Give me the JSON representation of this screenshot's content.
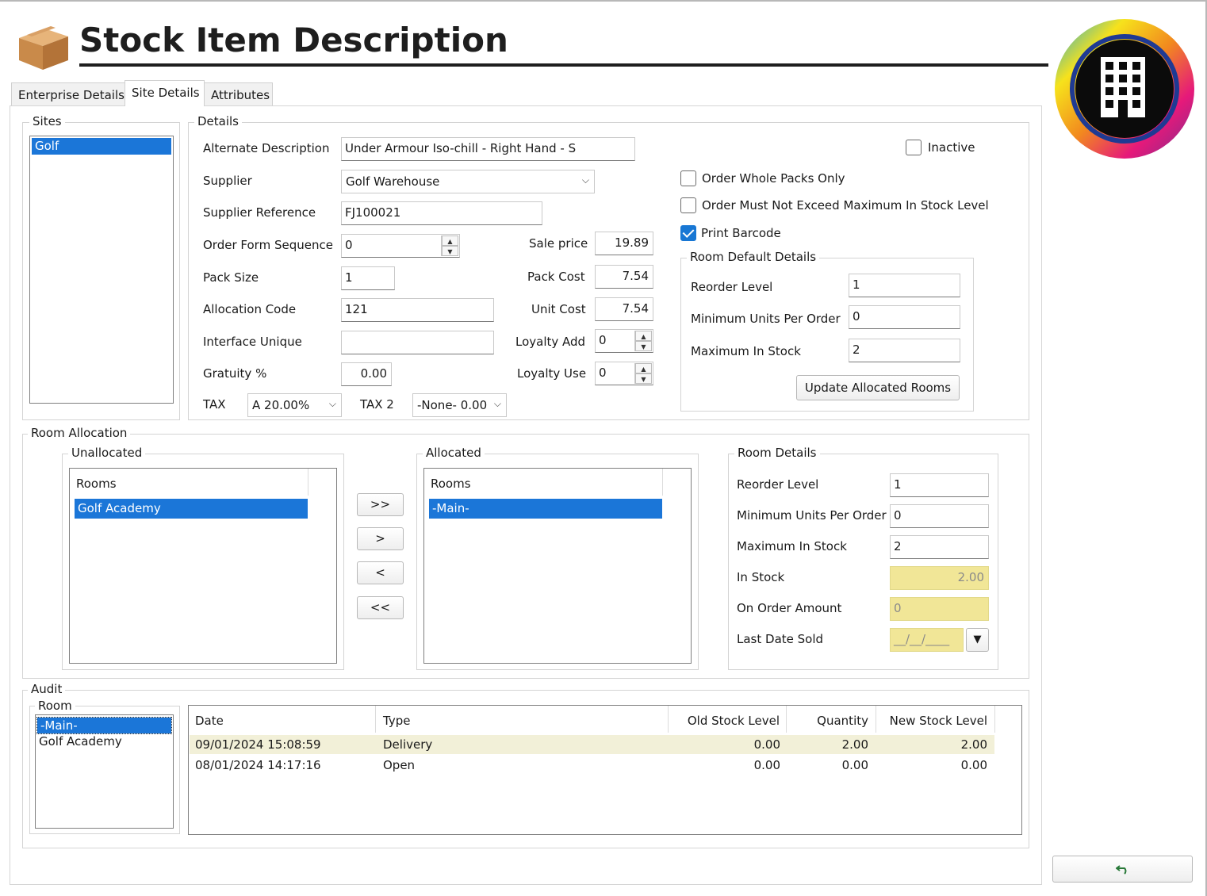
{
  "header": {
    "title": "Stock Item Description",
    "icon": "cardboard-box-icon",
    "logo": "building-ring-logo"
  },
  "tabs": [
    {
      "label": "Enterprise Details",
      "active": false
    },
    {
      "label": "Site Details",
      "active": true
    },
    {
      "label": "Attributes",
      "active": false
    }
  ],
  "sites": {
    "legend": "Sites",
    "items": [
      "Golf"
    ],
    "selected": "Golf"
  },
  "details": {
    "legend": "Details",
    "alternate_description": {
      "label": "Alternate Description",
      "value": "Under Armour Iso-chill - Right Hand - S"
    },
    "supplier": {
      "label": "Supplier",
      "value": "Golf Warehouse"
    },
    "supplier_reference": {
      "label": "Supplier Reference",
      "value": "FJ100021"
    },
    "order_form_sequence": {
      "label": "Order Form Sequence",
      "value": "0"
    },
    "pack_size": {
      "label": "Pack Size",
      "value": "1"
    },
    "allocation_code": {
      "label": "Allocation Code",
      "value": "121"
    },
    "interface_unique": {
      "label": "Interface Unique",
      "value": ""
    },
    "gratuity": {
      "label": "Gratuity %",
      "value": "0.00"
    },
    "tax": {
      "label": "TAX",
      "value": "A 20.00%"
    },
    "tax2": {
      "label": "TAX 2",
      "value": "-None- 0.00"
    },
    "sale_price": {
      "label": "Sale price",
      "value": "19.89"
    },
    "pack_cost": {
      "label": "Pack Cost",
      "value": "7.54"
    },
    "unit_cost": {
      "label": "Unit Cost",
      "value": "7.54"
    },
    "loyalty_add": {
      "label": "Loyalty Add",
      "value": "0"
    },
    "loyalty_use": {
      "label": "Loyalty Use",
      "value": "0"
    },
    "inactive": {
      "label": "Inactive",
      "checked": false
    },
    "order_whole_packs": {
      "label": "Order Whole Packs Only",
      "checked": false
    },
    "order_not_exceed": {
      "label": "Order Must Not Exceed Maximum In Stock Level",
      "checked": false
    },
    "print_barcode": {
      "label": "Print Barcode",
      "checked": true
    }
  },
  "room_defaults": {
    "legend": "Room Default Details",
    "reorder_level": {
      "label": "Reorder Level",
      "value": "1"
    },
    "min_units": {
      "label": "Minimum Units Per Order",
      "value": "0"
    },
    "max_in_stock": {
      "label": "Maximum In Stock",
      "value": "2"
    },
    "update_button": "Update Allocated Rooms"
  },
  "room_allocation": {
    "legend": "Room Allocation",
    "unallocated": {
      "legend": "Unallocated",
      "header": "Rooms",
      "items": [
        "Golf Academy"
      ]
    },
    "allocated": {
      "legend": "Allocated",
      "header": "Rooms",
      "items": [
        "-Main-"
      ]
    },
    "buttons": {
      "move_all_right": ">>",
      "move_right": ">",
      "move_left": "<",
      "move_all_left": "<<"
    }
  },
  "room_details": {
    "legend": "Room Details",
    "reorder_level": {
      "label": "Reorder Level",
      "value": "1"
    },
    "min_units": {
      "label": "Minimum Units Per Order",
      "value": "0"
    },
    "max_in_stock": {
      "label": "Maximum In Stock",
      "value": "2"
    },
    "in_stock": {
      "label": "In Stock",
      "value": "2.00"
    },
    "on_order": {
      "label": "On Order Amount",
      "value": "0"
    },
    "last_date_sold": {
      "label": "Last Date Sold",
      "value": "__/__/____"
    }
  },
  "audit": {
    "legend": "Audit",
    "room_legend": "Room",
    "rooms": [
      "-Main-",
      "Golf Academy"
    ],
    "columns": [
      "Date",
      "Type",
      "Old Stock Level",
      "Quantity",
      "New Stock Level"
    ],
    "rows": [
      {
        "date": "09/01/2024 15:08:59",
        "type": "Delivery",
        "old": "0.00",
        "qty": "2.00",
        "new": "2.00"
      },
      {
        "date": "08/01/2024 14:17:16",
        "type": "Open",
        "old": "0.00",
        "qty": "0.00",
        "new": "0.00"
      }
    ]
  },
  "footer": {
    "undo_icon": "undo-arrow-icon"
  }
}
